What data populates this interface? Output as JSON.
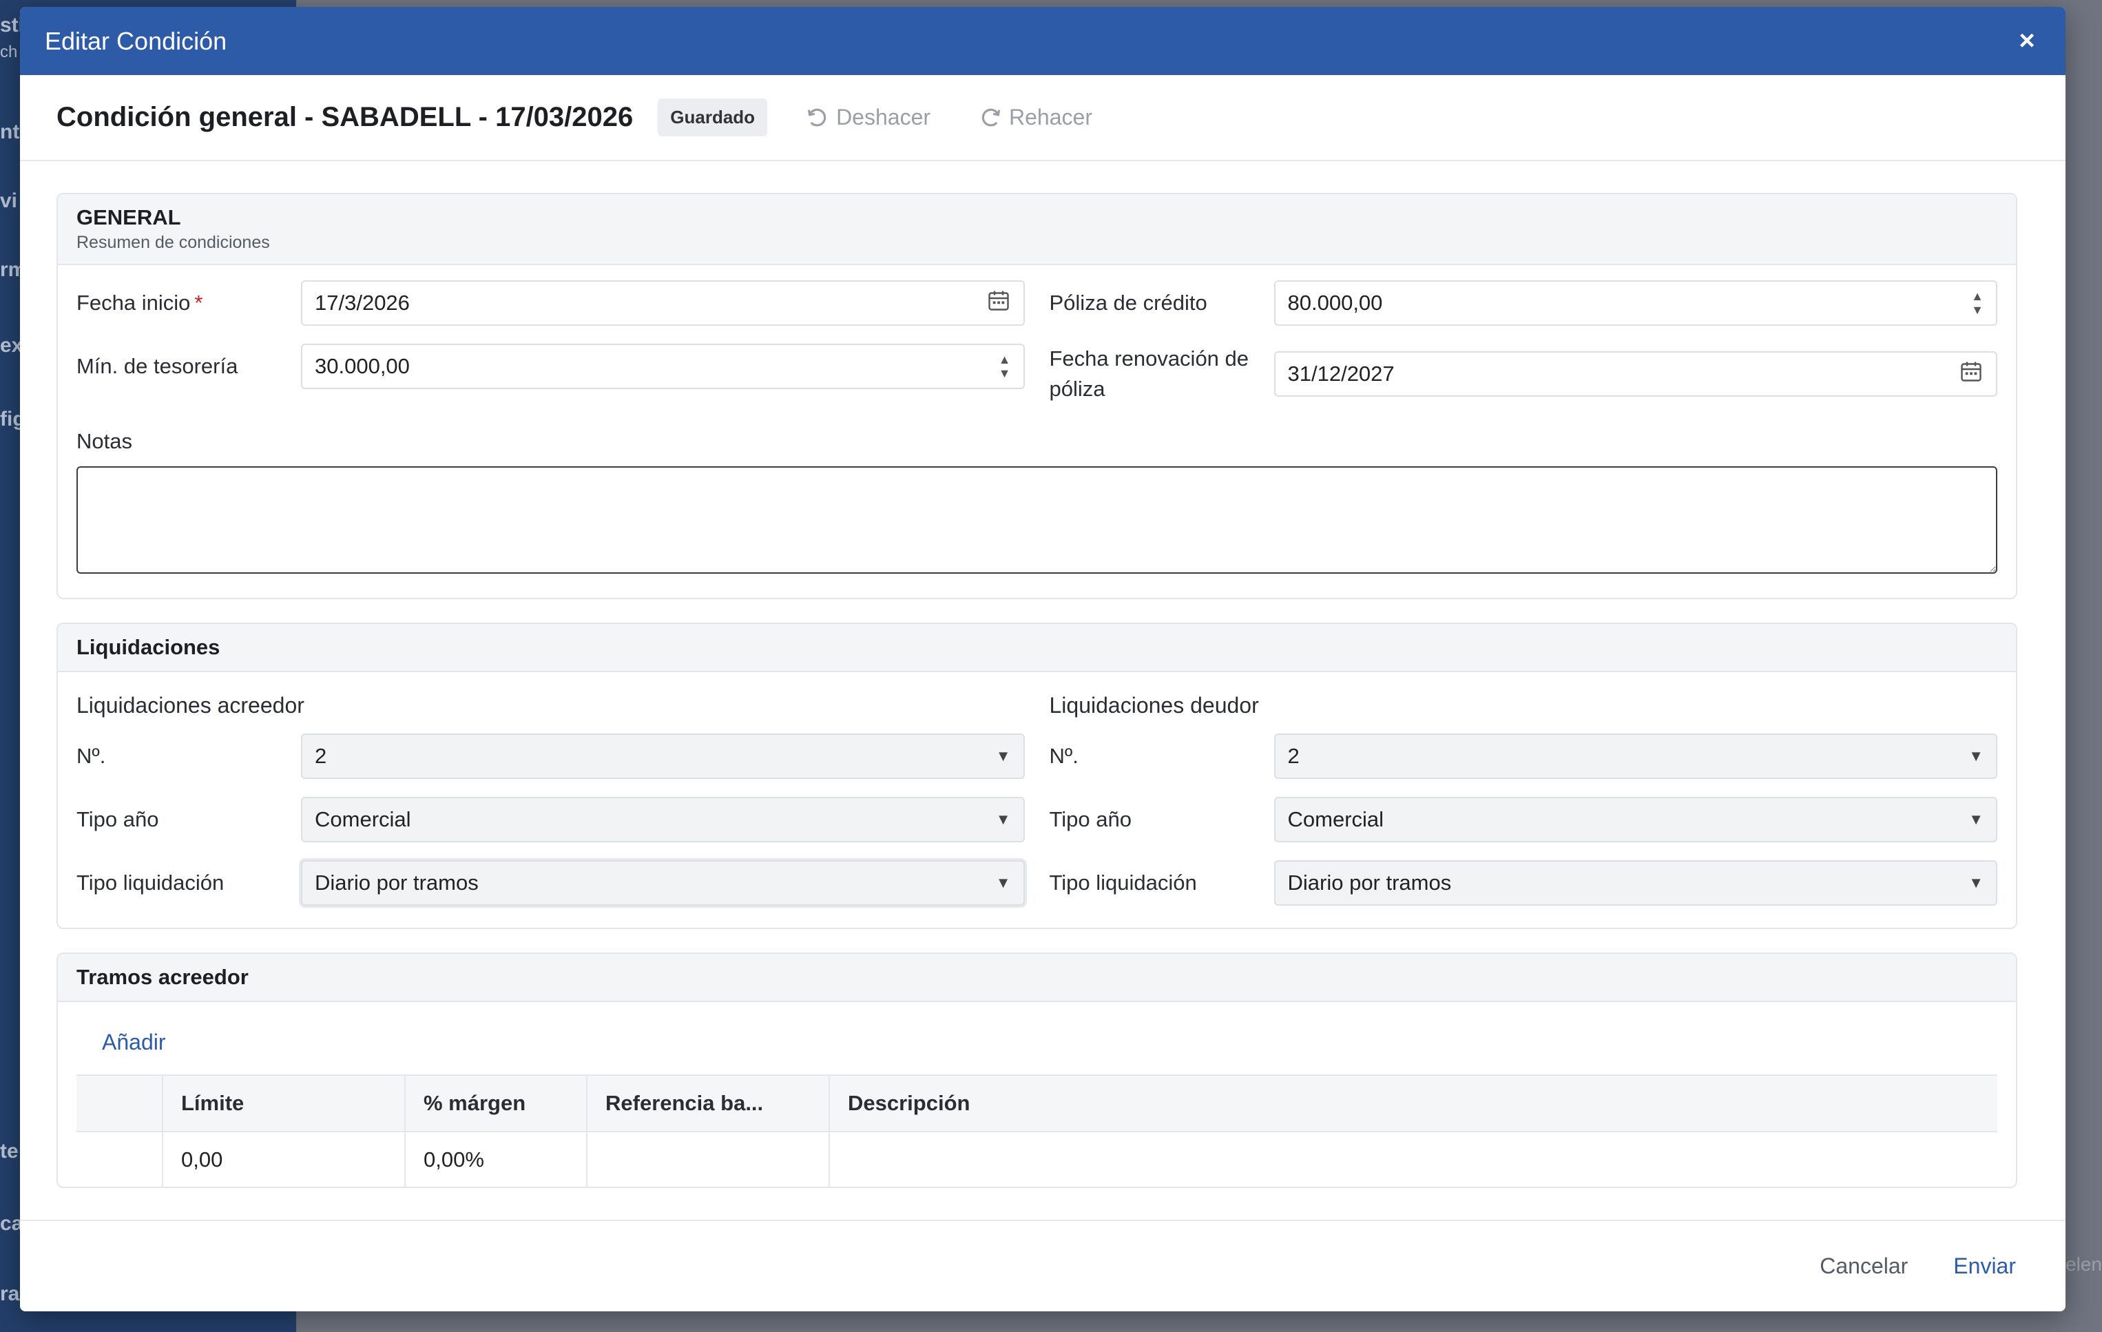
{
  "background": {
    "fragments_left": [
      "sti",
      "ch",
      "nt",
      "vi",
      "rm",
      "ex",
      "fig",
      "te",
      "ca",
      "ra"
    ],
    "fragment_right": "elen"
  },
  "modal": {
    "title": "Editar Condición",
    "close_icon": "×"
  },
  "subheader": {
    "title": "Condición general - SABADELL - 17/03/2026",
    "badge": "Guardado",
    "undo_label": "Deshacer",
    "redo_label": "Rehacer"
  },
  "general": {
    "title": "GENERAL",
    "subtitle": "Resumen de condiciones",
    "fecha_inicio_label": "Fecha inicio",
    "required_mark": "*",
    "fecha_inicio_value": "17/3/2026",
    "poliza_credito_label": "Póliza de crédito",
    "poliza_credito_value": "80.000,00",
    "min_tesoreria_label": "Mín. de tesorería",
    "min_tesoreria_value": "30.000,00",
    "fecha_renovacion_label": "Fecha renovación de póliza",
    "fecha_renovacion_value": "31/12/2027",
    "notas_label": "Notas",
    "notas_value": ""
  },
  "liquidaciones": {
    "title": "Liquidaciones",
    "acreedor": {
      "title": "Liquidaciones acreedor",
      "num_label": "Nº.",
      "num_value": "2",
      "tipo_anio_label": "Tipo año",
      "tipo_anio_value": "Comercial",
      "tipo_liq_label": "Tipo liquidación",
      "tipo_liq_value": "Diario por tramos"
    },
    "deudor": {
      "title": "Liquidaciones deudor",
      "num_label": "Nº.",
      "num_value": "2",
      "tipo_anio_label": "Tipo año",
      "tipo_anio_value": "Comercial",
      "tipo_liq_label": "Tipo liquidación",
      "tipo_liq_value": "Diario por tramos"
    }
  },
  "tramos": {
    "title": "Tramos acreedor",
    "add_label": "Añadir",
    "columns": [
      "",
      "Límite",
      "% márgen",
      "Referencia ba...",
      "Descripción"
    ],
    "rows": [
      [
        "",
        "0,00",
        "0,00%",
        "",
        ""
      ]
    ]
  },
  "footer": {
    "cancel_label": "Cancelar",
    "send_label": "Enviar"
  },
  "colors": {
    "header_blue": "#2d5ba8",
    "sidebar_bg": "#233f6a",
    "required_red": "#d01e1e"
  }
}
